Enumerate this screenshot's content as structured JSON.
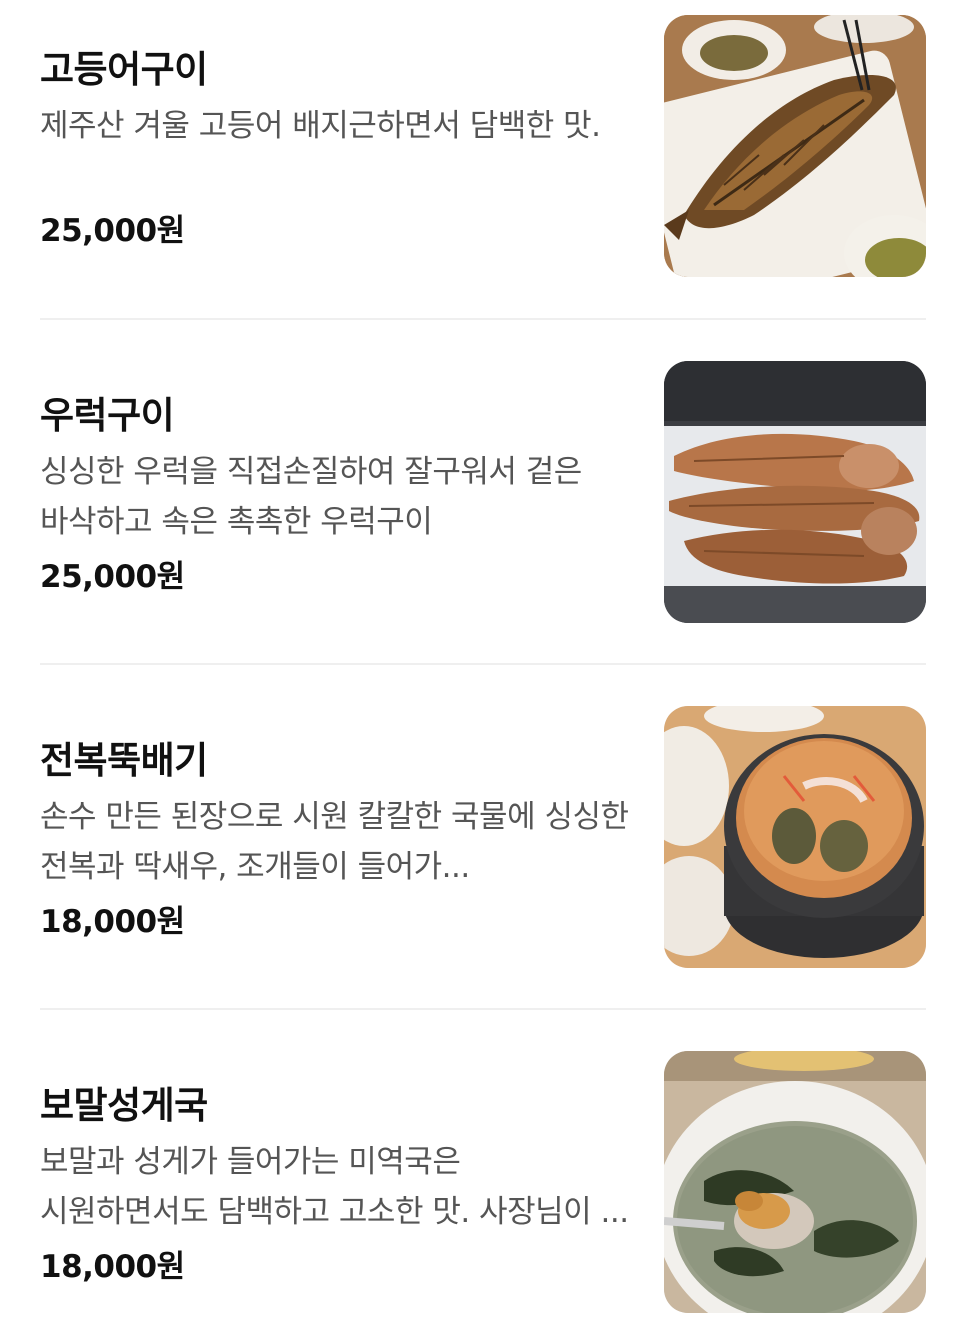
{
  "menu": {
    "items": [
      {
        "name": "고등어구이",
        "description": "제주산 겨울 고등어 배지근하면서 담백한 맛.",
        "price": "25,000원",
        "image_icon": "grilled-mackerel-photo"
      },
      {
        "name": "우럭구이",
        "description": "싱싱한 우럭을 직접손질하여 잘구워서 겉은 바삭하고 속은 촉촉한 우럭구이",
        "price": "25,000원",
        "image_icon": "grilled-rockfish-photo"
      },
      {
        "name": "전복뚝배기",
        "description": "손수 만든 된장으로 시원 칼칼한 국물에 싱싱한 전복과 딱새우, 조개들이 들어가...",
        "price": "18,000원",
        "image_icon": "abalone-stew-photo"
      },
      {
        "name": "보말성게국",
        "description": "보말과 성게가 들어가는 미역국은 시원하면서도 담백하고 고소한 맛. 사장님이 ...",
        "price": "18,000원",
        "image_icon": "sea-urchin-soup-photo"
      }
    ]
  }
}
